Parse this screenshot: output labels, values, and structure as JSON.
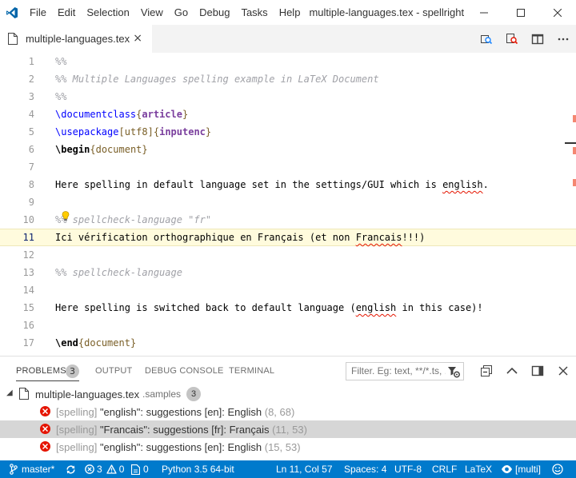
{
  "colors": {
    "accent": "#007acc",
    "error": "#e51400",
    "current_line": "#fffbdd"
  },
  "titlebar": {
    "menu": [
      "File",
      "Edit",
      "Selection",
      "View",
      "Go",
      "Debug",
      "Tasks",
      "Help"
    ],
    "title": "multiple-languages.tex - spellright",
    "controls": [
      "minimize-icon",
      "maximize-icon",
      "close-icon"
    ]
  },
  "tab": {
    "label": "multiple-languages.tex",
    "close": "×"
  },
  "editor": {
    "current_line": 11,
    "lines": [
      {
        "n": "1",
        "text": "%%"
      },
      {
        "n": "2",
        "text": "%% Multiple Languages spelling example in LaTeX Document"
      },
      {
        "n": "3",
        "text": "%%"
      },
      {
        "n": "4",
        "cmd": "\\documentclass",
        "open": "{",
        "arg": "article",
        "close": "}"
      },
      {
        "n": "5",
        "cmd": "\\usepackage",
        "opt_open": "[",
        "opt": "utf8",
        "opt_close": "]",
        "open": "{",
        "arg": "inputenc",
        "close": "}"
      },
      {
        "n": "6",
        "cmd": "\\begin",
        "open": "{",
        "arg": "document",
        "close": "}"
      },
      {
        "n": "7",
        "text": ""
      },
      {
        "n": "8",
        "pre": "Here spelling in default language set in the settings/GUI which is ",
        "bad": "english",
        "post": "."
      },
      {
        "n": "9",
        "text": ""
      },
      {
        "n": "10",
        "pre": "%%",
        "text": " spellcheck-language \"fr\""
      },
      {
        "n": "11",
        "pre": "Ici vérification orthographique en Français (et non ",
        "bad": "Francais",
        "post": "!!!)"
      },
      {
        "n": "12",
        "text": ""
      },
      {
        "n": "13",
        "text": "%% spellcheck-language"
      },
      {
        "n": "14",
        "text": ""
      },
      {
        "n": "15",
        "pre": "Here spelling is switched back to default language (",
        "bad": "english",
        "post": " in this case)!"
      },
      {
        "n": "16",
        "text": ""
      },
      {
        "n": "17",
        "cmd": "\\end",
        "open": "{",
        "arg": "document",
        "close": "}"
      }
    ]
  },
  "panel": {
    "tabs": [
      "PROBLEMS",
      "OUTPUT",
      "DEBUG CONSOLE",
      "TERMINAL"
    ],
    "problems_count": "3",
    "filter_placeholder": "Filter. Eg: text, **/*.ts, ...",
    "file": {
      "name": "multiple-languages.tex",
      "dir": ".samples",
      "count": "3"
    },
    "problems": [
      {
        "source": "[spelling]",
        "message": "\"english\": suggestions [en]: English",
        "pos": "(8, 68)"
      },
      {
        "source": "[spelling]",
        "message": "\"Francais\": suggestions [fr]: Français",
        "pos": "(11, 53)"
      },
      {
        "source": "[spelling]",
        "message": "\"english\": suggestions [en]: English",
        "pos": "(15, 53)"
      }
    ]
  },
  "statusbar": {
    "branch": "master*",
    "errors": "3",
    "warnings": "0",
    "info": "0",
    "python": "Python 3.5 64-bit",
    "position": "Ln 11, Col 57",
    "spaces": "Spaces: 4",
    "encoding": "UTF-8",
    "eol": "CRLF",
    "language": "LaTeX",
    "spell_lang": "[multi]"
  }
}
